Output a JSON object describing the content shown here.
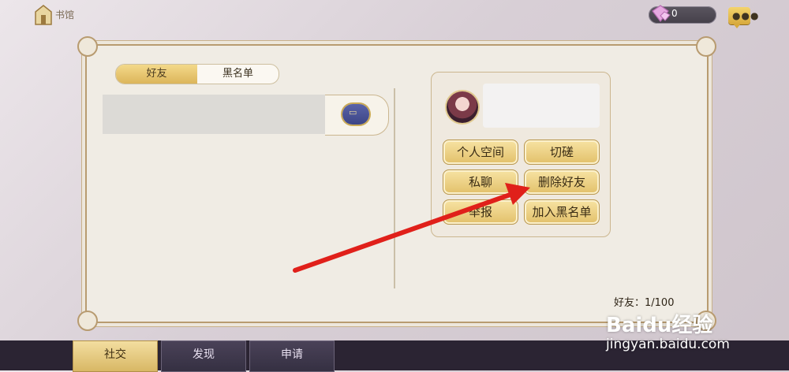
{
  "topbar": {
    "home_label": "书馆",
    "gem_count": "0"
  },
  "tabs": [
    {
      "label": "好友",
      "active": true
    },
    {
      "label": "黑名单",
      "active": false
    }
  ],
  "profile_actions": [
    {
      "label": "个人空间"
    },
    {
      "label": "切磋"
    },
    {
      "label": "私聊"
    },
    {
      "label": "删除好友"
    },
    {
      "label": "举报"
    },
    {
      "label": "加入黑名单"
    }
  ],
  "friend_count": "好友：1/100",
  "footer_tabs": [
    {
      "label": "社交",
      "active": true
    },
    {
      "label": "发现",
      "active": false
    },
    {
      "label": "申请",
      "active": false
    }
  ],
  "watermark": {
    "brand": "Baidu经验",
    "url": "jingyan.baidu.com"
  },
  "colors": {
    "accent_gold": "#dcb55a",
    "annotation_arrow": "#e0201a",
    "footer_dark": "#2b2433"
  }
}
